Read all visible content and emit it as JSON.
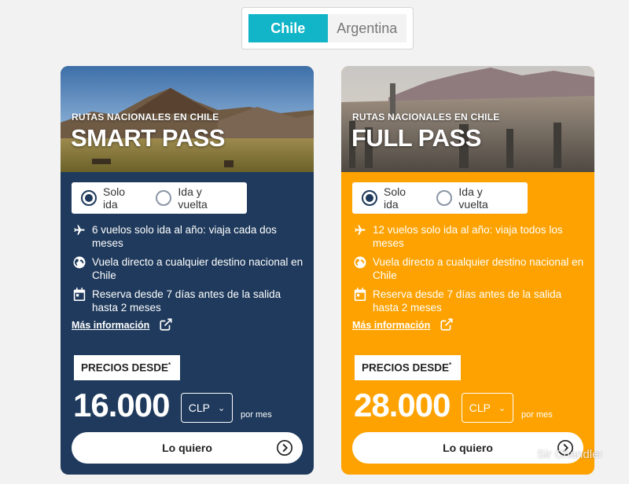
{
  "country_tabs": [
    {
      "label": "Chile",
      "active": true
    },
    {
      "label": "Argentina",
      "active": false
    }
  ],
  "cards": [
    {
      "subtitle": "RUTAS NACIONALES EN CHILE",
      "title": "SMART PASS",
      "trip_options": [
        "Solo ida",
        "Ida y vuelta"
      ],
      "selected_trip": "Solo ida",
      "features": [
        "6 vuelos solo ida al año: viaja cada dos meses",
        "Vuela directo a cualquier destino nacional en Chile",
        "Reserva desde 7 días antes de la salida hasta 2 meses"
      ],
      "more_info": "Más información",
      "price_label": "PRECIOS DESDE",
      "price_note_mark": "*",
      "price": "16.000",
      "currency": "CLP",
      "per_month": "por mes",
      "cta": "Lo quiero",
      "bg_color": "#1f3a5c"
    },
    {
      "subtitle": "RUTAS NACIONALES EN CHILE",
      "title": "FULL PASS",
      "trip_options": [
        "Solo ida",
        "Ida y vuelta"
      ],
      "selected_trip": "Solo ida",
      "features": [
        "12 vuelos solo ida al año: viaja todos los meses",
        "Vuela directo a cualquier destino nacional en Chile",
        "Reserva desde 7 días antes de la salida hasta 2 meses"
      ],
      "more_info": "Más información",
      "price_label": "PRECIOS DESDE",
      "price_note_mark": "*",
      "price": "28.000",
      "currency": "CLP",
      "per_month": "por mes",
      "cta": "Lo quiero",
      "bg_color": "#fda200"
    }
  ],
  "watermark": "Sir Chandler",
  "icons": {
    "feature_1": "airplane-icon",
    "feature_2": "globe-icon",
    "feature_3": "calendar-icon",
    "more_info": "external-link-icon",
    "cta": "arrow-right-circle-icon"
  },
  "colors": {
    "accent": "#12b5c8",
    "smart_card": "#1f3a5c",
    "full_card": "#fda200"
  }
}
